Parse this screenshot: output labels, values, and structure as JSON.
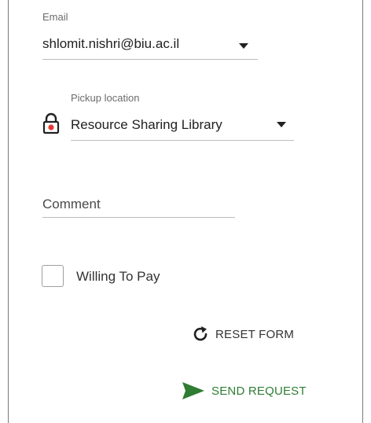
{
  "form": {
    "email": {
      "label": "Email",
      "value": "shlomit.nishri@biu.ac.il"
    },
    "pickup": {
      "label": "Pickup location",
      "value": "Resource Sharing Library",
      "icon": "lock-icon"
    },
    "comment": {
      "placeholder": "Comment",
      "value": ""
    },
    "willing_to_pay": {
      "label": "Willing To Pay",
      "checked": false
    },
    "reset_label": "RESET FORM",
    "send_label": "SEND REQUEST"
  },
  "colors": {
    "send": "#2e7d32",
    "lock_badge": "#e53935",
    "border": "#bdbdbd"
  }
}
